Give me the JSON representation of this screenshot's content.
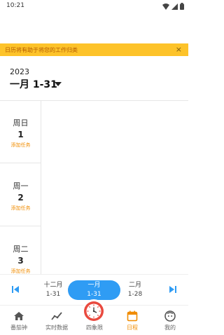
{
  "status_bar": {
    "time": "10:21"
  },
  "banner": {
    "text": "日历将有助于将您的工作归类",
    "close_glyph": "×"
  },
  "calendar": {
    "year": "2023",
    "range": "一月 1-31",
    "days": [
      {
        "name": "周日",
        "date": "1",
        "add": "添加任务"
      },
      {
        "name": "周一",
        "date": "2",
        "add": "添加任务"
      },
      {
        "name": "周二",
        "date": "3",
        "add": "添加任务"
      }
    ]
  },
  "month_nav": {
    "prev": {
      "month": "十二月",
      "range": "1-31"
    },
    "current": {
      "month": "一月",
      "range": "1-31"
    },
    "next": {
      "month": "二月",
      "range": "1-28"
    }
  },
  "tab_bar": {
    "accent_color": "#f08c00",
    "tabs": [
      {
        "label": "番茄钟",
        "icon": "home-icon"
      },
      {
        "label": "实时数据",
        "icon": "chart-line-icon"
      },
      {
        "label": "四象限",
        "icon": "clock-icon"
      },
      {
        "label": "日程",
        "icon": "calendar-icon",
        "active": true
      },
      {
        "label": "我的",
        "icon": "face-icon"
      }
    ]
  }
}
